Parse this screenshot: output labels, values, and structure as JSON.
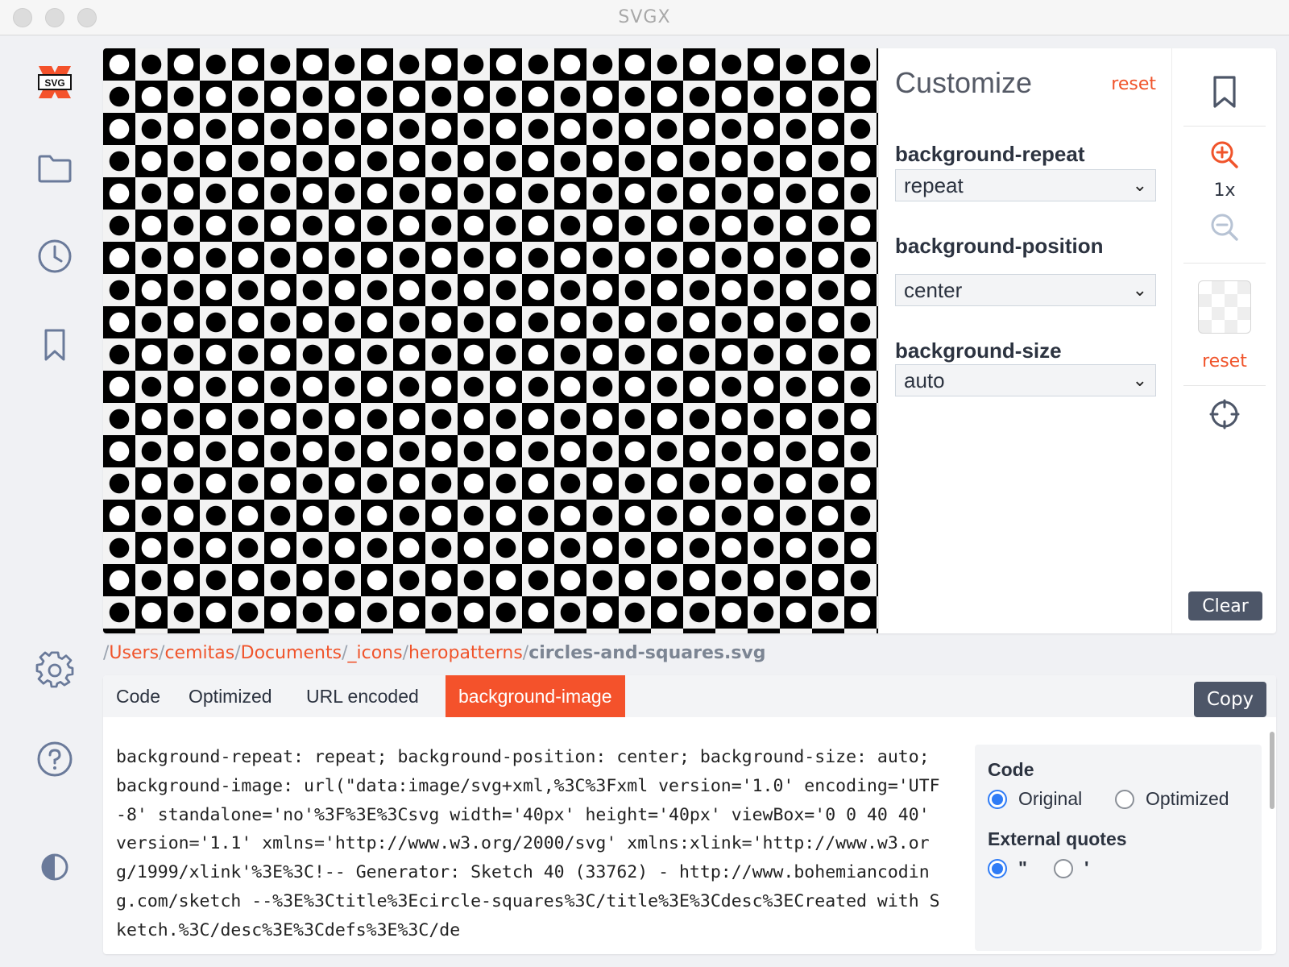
{
  "window": {
    "title": "SVGX"
  },
  "sidebar": {
    "logo_text": "SVG",
    "items": [
      {
        "name": "folder-icon"
      },
      {
        "name": "clock-icon"
      },
      {
        "name": "bookmark-icon"
      },
      {
        "name": "gear-icon"
      },
      {
        "name": "help-icon"
      },
      {
        "name": "contrast-icon"
      }
    ]
  },
  "customize": {
    "title": "Customize",
    "reset_label": "reset",
    "fields": [
      {
        "label": "background-repeat",
        "value": "repeat"
      },
      {
        "label": "background-position",
        "value": "center"
      },
      {
        "label": "background-size",
        "value": "auto"
      }
    ]
  },
  "tools": {
    "zoom_level": "1x",
    "reset_label": "reset",
    "clear_label": "Clear"
  },
  "path": {
    "segments": [
      "Users",
      "cemitas",
      "Documents",
      "_icons",
      "heropatterns"
    ],
    "file": "circles-and-squares.svg"
  },
  "code_panel": {
    "tabs": [
      "Code",
      "Optimized",
      "URL encoded",
      "background-image"
    ],
    "active_tab": "background-image",
    "copy_label": "Copy",
    "content": "background-repeat: repeat; background-position: center; background-size: auto; background-image: url(\"data:image/svg+xml,%3C%3Fxml version='1.0' encoding='UTF-8' standalone='no'%3F%3E%3Csvg width='40px' height='40px' viewBox='0 0 40 40' version='1.1' xmlns='http://www.w3.org/2000/svg' xmlns:xlink='http://www.w3.org/1999/xlink'%3E%3C!-- Generator: Sketch 40 (33762) - http://www.bohemiancoding.com/sketch --%3E%3Ctitle%3Ecircle-squares%3C/title%3E%3Cdesc%3ECreated with Sketch.%3C/desc%3E%3Cdefs%3E%3C/de",
    "options": {
      "code_label": "Code",
      "code_options": [
        "Original",
        "Optimized"
      ],
      "code_selected": "Original",
      "quotes_label": "External quotes",
      "quote_options": [
        "\"",
        "'"
      ],
      "quote_selected": "\""
    }
  },
  "colors": {
    "accent": "#f4522b",
    "button": "#4d5668",
    "radio": "#2f7cf6"
  }
}
